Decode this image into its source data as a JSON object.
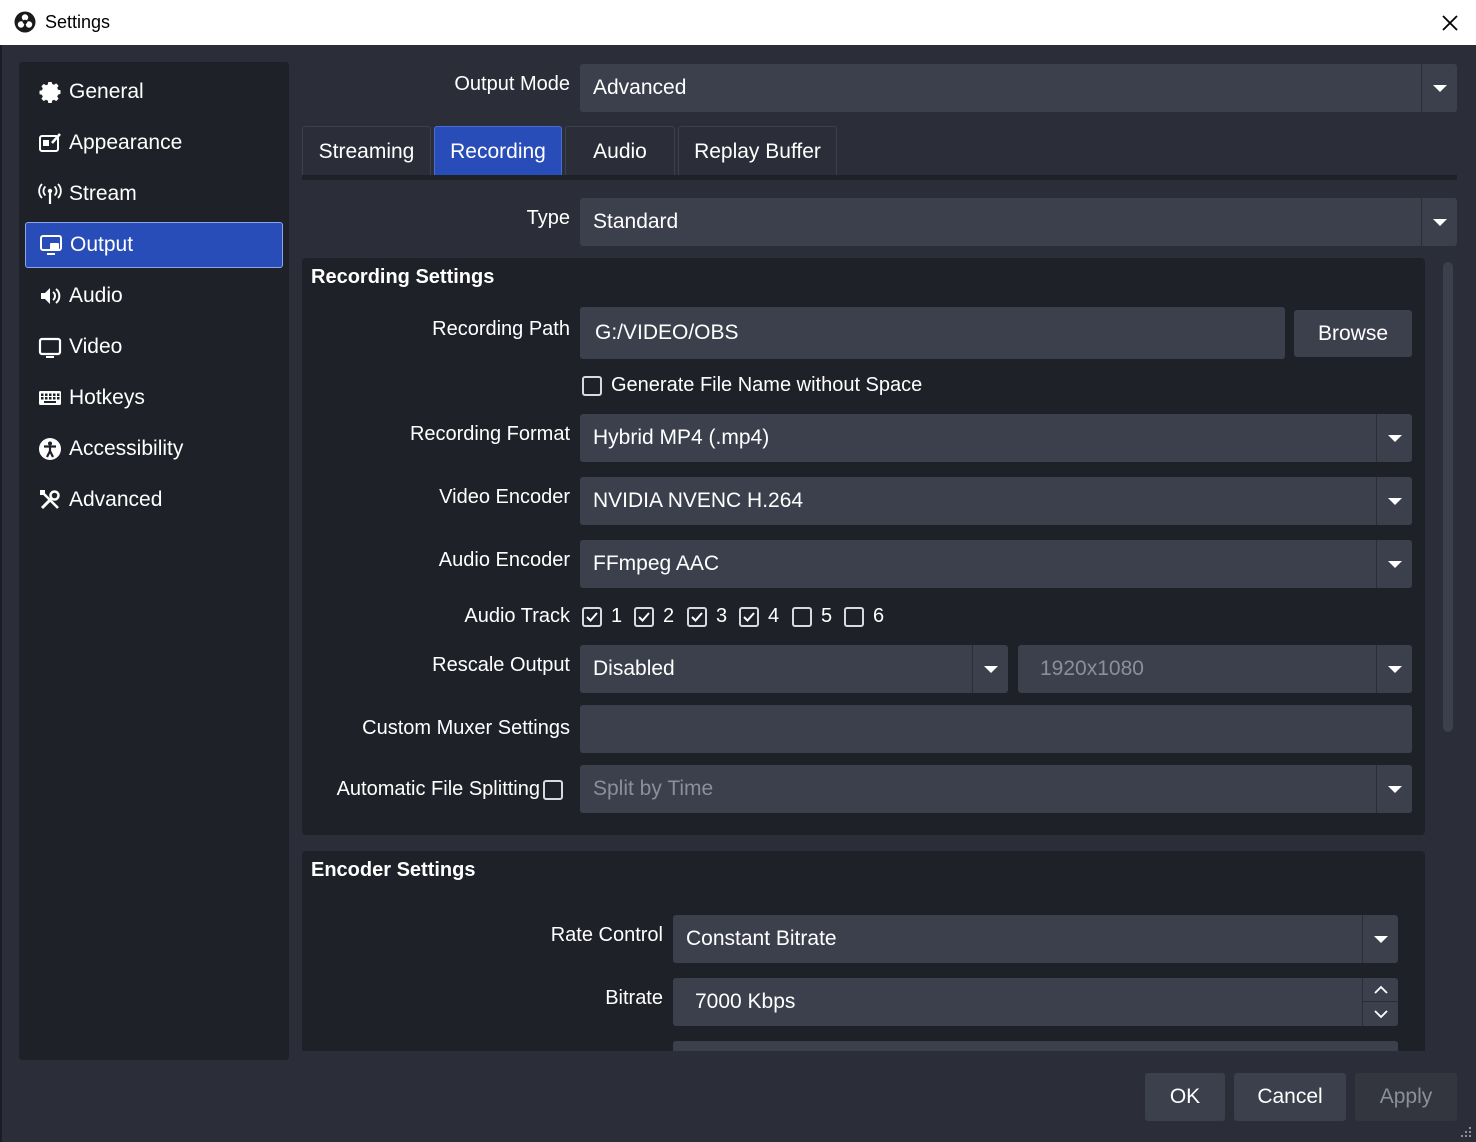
{
  "window": {
    "title": "Settings",
    "icon": "obs-logo-icon",
    "close_icon": "close-icon"
  },
  "sidebar": {
    "items": [
      {
        "label": "General",
        "icon": "gear-icon",
        "active": false
      },
      {
        "label": "Appearance",
        "icon": "appearance-icon",
        "active": false
      },
      {
        "label": "Stream",
        "icon": "antenna-icon",
        "active": false
      },
      {
        "label": "Output",
        "icon": "output-icon",
        "active": true
      },
      {
        "label": "Audio",
        "icon": "speaker-icon",
        "active": false
      },
      {
        "label": "Video",
        "icon": "monitor-icon",
        "active": false
      },
      {
        "label": "Hotkeys",
        "icon": "keyboard-icon",
        "active": false
      },
      {
        "label": "Accessibility",
        "icon": "accessibility-icon",
        "active": false
      },
      {
        "label": "Advanced",
        "icon": "tools-icon",
        "active": false
      }
    ]
  },
  "output_mode": {
    "label": "Output Mode",
    "value": "Advanced"
  },
  "tabs": [
    {
      "label": "Streaming",
      "active": false
    },
    {
      "label": "Recording",
      "active": true
    },
    {
      "label": "Audio",
      "active": false
    },
    {
      "label": "Replay Buffer",
      "active": false
    }
  ],
  "type": {
    "label": "Type",
    "value": "Standard"
  },
  "recording_settings": {
    "title": "Recording Settings",
    "path": {
      "label": "Recording Path",
      "value": "G:/VIDEO/OBS",
      "browse_label": "Browse"
    },
    "no_space": {
      "label": "Generate File Name without Space",
      "checked": false
    },
    "format": {
      "label": "Recording Format",
      "value": "Hybrid MP4 (.mp4)"
    },
    "video_encoder": {
      "label": "Video Encoder",
      "value": "NVIDIA NVENC H.264"
    },
    "audio_encoder": {
      "label": "Audio Encoder",
      "value": "FFmpeg AAC"
    },
    "audio_track": {
      "label": "Audio Track",
      "tracks": [
        {
          "label": "1",
          "checked": true
        },
        {
          "label": "2",
          "checked": true
        },
        {
          "label": "3",
          "checked": true
        },
        {
          "label": "4",
          "checked": true
        },
        {
          "label": "5",
          "checked": false
        },
        {
          "label": "6",
          "checked": false
        }
      ]
    },
    "rescale": {
      "label": "Rescale Output",
      "value": "Disabled",
      "resolution": "1920x1080"
    },
    "muxer": {
      "label": "Custom Muxer Settings",
      "value": ""
    },
    "splitting": {
      "label": "Automatic File Splitting",
      "checked": false,
      "value": "Split by Time"
    }
  },
  "encoder_settings": {
    "title": "Encoder Settings",
    "rate_control": {
      "label": "Rate Control",
      "value": "Constant Bitrate"
    },
    "bitrate": {
      "label": "Bitrate",
      "value": "7000 Kbps"
    }
  },
  "buttons": {
    "ok": "OK",
    "cancel": "Cancel",
    "apply": "Apply"
  }
}
